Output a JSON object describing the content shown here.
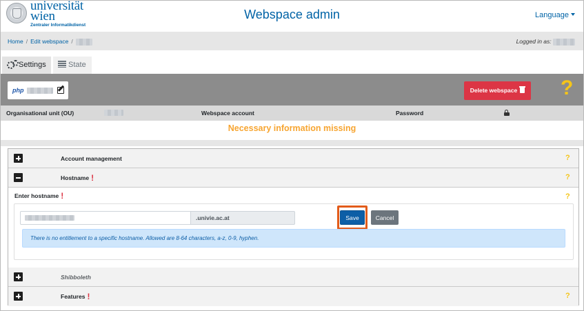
{
  "header": {
    "logo_name_line1": "universität",
    "logo_name_line2": "wien",
    "logo_subtitle": "Zentraler Informatikdienst",
    "app_title": "Webspace admin",
    "language_label": "Language"
  },
  "breadcrumb": {
    "items": [
      "Home",
      "Edit webspace"
    ],
    "separator": "/",
    "logged_in_label": "Logged in as:"
  },
  "tabs": [
    {
      "label": "Settings",
      "active": true
    },
    {
      "label": "State",
      "active": false
    }
  ],
  "toolbar": {
    "php_label": "php",
    "delete_label": "Delete webspace",
    "help_glyph": "?"
  },
  "columns": {
    "ou": "Organisational unit (OU)",
    "account": "Webspace account",
    "password": "Password"
  },
  "alert": "Necessary information missing",
  "sections": {
    "account_management": "Account management",
    "hostname": "Hostname",
    "shibboleth": "Shibboleth",
    "features": "Features",
    "help_glyph": "?",
    "required_glyph": "!"
  },
  "hostname_form": {
    "label": "Enter hostname",
    "input_value": "",
    "suffix": ".univie.ac.at",
    "save_label": "Save",
    "cancel_label": "Cancel",
    "info_text": "There is no entitlement to a specific hostname. Allowed are 8-64 characters, a-z, 0-9, hyphen."
  },
  "colors": {
    "brand_blue": "#0063a6",
    "danger": "#dc3545",
    "warning": "#f7a531",
    "help_yellow": "#f5c518",
    "highlight_ring": "#e25b1a"
  }
}
